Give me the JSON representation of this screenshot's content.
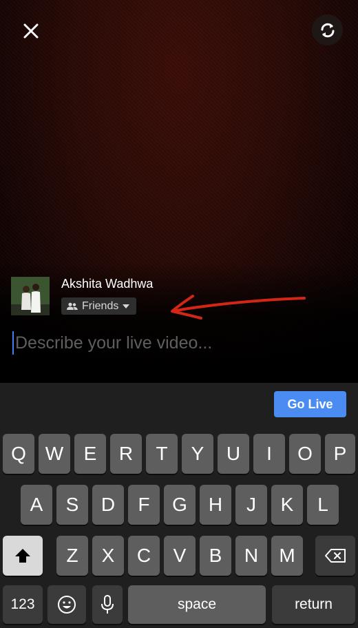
{
  "user": {
    "name": "Akshita Wadhwa"
  },
  "privacy": {
    "label": "Friends"
  },
  "description": {
    "placeholder": "Describe your live video..."
  },
  "actions": {
    "go_live": "Go Live"
  },
  "keyboard": {
    "row1": [
      "Q",
      "W",
      "E",
      "R",
      "T",
      "Y",
      "U",
      "I",
      "O",
      "P"
    ],
    "row2": [
      "A",
      "S",
      "D",
      "F",
      "G",
      "H",
      "J",
      "K",
      "L"
    ],
    "row3": [
      "Z",
      "X",
      "C",
      "V",
      "B",
      "N",
      "M"
    ],
    "numbers_label": "123",
    "space_label": "space",
    "return_label": "return"
  },
  "colors": {
    "accent": "#4a8cf2",
    "annotation_arrow": "#d32617",
    "cursor": "#4a7cf5"
  }
}
